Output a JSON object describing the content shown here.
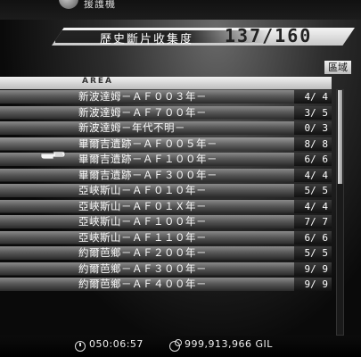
{
  "top_partial_text": "援護機",
  "collection": {
    "label": "歷史斷片收集度",
    "value": "137/160"
  },
  "sort_label": "區域",
  "list_header": "AREA",
  "selected_index": 3,
  "rows": [
    {
      "name": "新波達姆－ＡＦ００３年－",
      "count": "4/ 4"
    },
    {
      "name": "新波達姆－ＡＦ７００年－",
      "count": "3/ 5"
    },
    {
      "name": "新波達姆－年代不明－",
      "count": "0/ 3"
    },
    {
      "name": "畢爾吉遺跡－ＡＦ００５年－",
      "count": "8/ 8"
    },
    {
      "name": "畢爾吉遺跡－ＡＦ１００年－",
      "count": "6/ 6"
    },
    {
      "name": "畢爾吉遺跡－ＡＦ３００年－",
      "count": "4/ 4"
    },
    {
      "name": "亞峽斯山－ＡＦ０１０年－",
      "count": "5/ 5"
    },
    {
      "name": "亞峽斯山－ＡＦ０１Ｘ年－",
      "count": "4/ 4"
    },
    {
      "name": "亞峽斯山－ＡＦ１００年－",
      "count": "7/ 7"
    },
    {
      "name": "亞峽斯山－ＡＦ１１０年－",
      "count": "6/ 6"
    },
    {
      "name": "約爾芭鄉－ＡＦ２００年－",
      "count": "5/ 5"
    },
    {
      "name": "約爾芭鄉－ＡＦ３００年－",
      "count": "9/ 9"
    },
    {
      "name": "約爾芭鄉－ＡＦ４００年－",
      "count": "9/ 9"
    }
  ],
  "footer": {
    "playtime": "050:06:57",
    "gil": "999,913,966 GIL"
  },
  "colors": {
    "row_dark": "#2a2a2a",
    "row_light": "#8a8a8a",
    "accent_white": "#f2f2f2"
  }
}
